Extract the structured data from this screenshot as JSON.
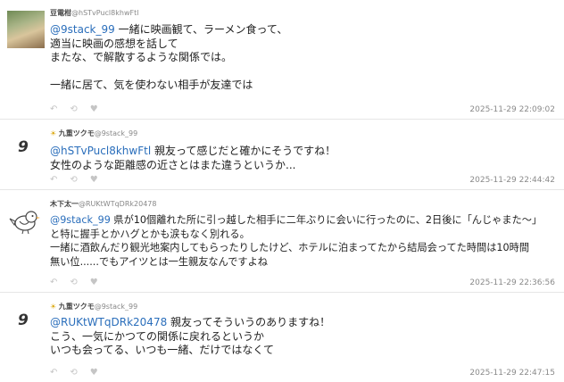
{
  "posts": [
    {
      "name": "豆電柑",
      "handle": "@hSTvPucl8khwFtl",
      "reply_to": "@9stack_99",
      "lines": [
        "一緒に映画観て、ラーメン食って、",
        "適当に映画の感想を話して",
        "またな、で解散するような関係では。",
        "",
        "一緒に居て、気を使わない相手が友達では"
      ],
      "time": "2025-11-29 22:09:02"
    },
    {
      "name": "九重ツクモ",
      "handle": "@9stack_99",
      "reply_to": "@hSTvPucl8khwFtl",
      "lines": [
        "親友って感じだと確かにそうですね！",
        "女性のような距離感の近さとはまた違うというか..."
      ],
      "time": "2025-11-29 22:44:42"
    },
    {
      "name": "木下太一",
      "handle": "@RUKtWTqDRk20478",
      "reply_to": "@9stack_99",
      "lines": [
        "県が10個離れた所に引っ越した相手に二年ぶりに会いに行ったのに、2日後に「んじゃまた〜」",
        "と特に握手とかハグとかも涙もなく別れる。",
        "一緒に酒飲んだり観光地案内してもらったりしたけど、ホテルに泊まってたから結局会ってた時間は10時間",
        "無い位......でもアイツとは一生親友なんですよね"
      ],
      "time": "2025-11-29 22:36:56"
    },
    {
      "name": "九重ツクモ",
      "handle": "@9stack_99",
      "reply_to": "@RUKtWTqDRk20478",
      "lines": [
        "親友ってそういうのありますね！",
        "こう、一気にかつての関係に戻れるというか",
        "いつも会ってる、いつも一緒、だけではなくて"
      ],
      "time": "2025-11-29 22:47:15"
    }
  ],
  "avatar_text": "9",
  "colors": {
    "mention": "#2a6ebb",
    "timestamp": "#8a8a8a",
    "divider": "#e6e6e6"
  }
}
